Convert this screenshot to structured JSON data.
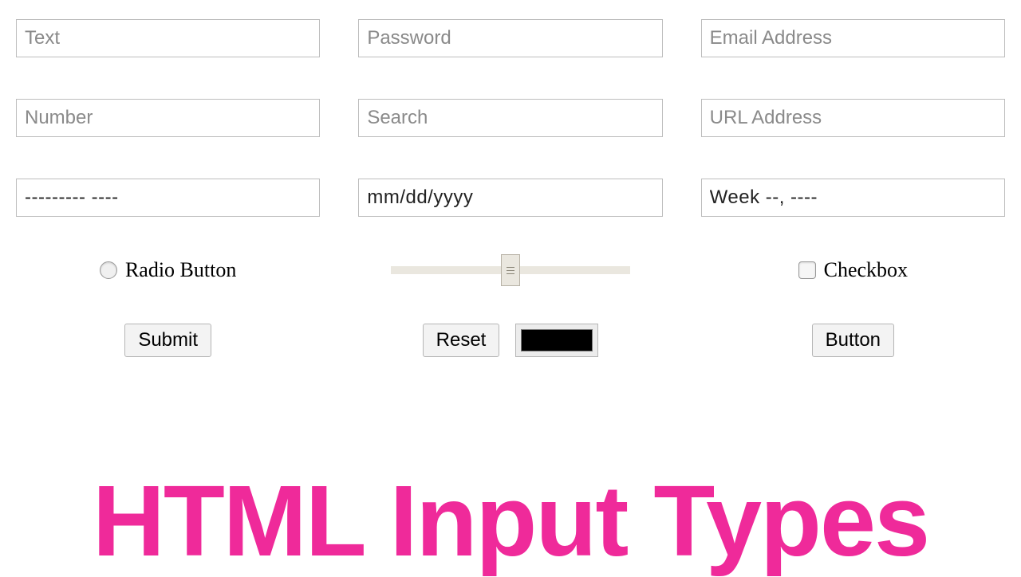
{
  "row1": {
    "text": {
      "placeholder": "Text"
    },
    "password": {
      "placeholder": "Password"
    },
    "email": {
      "placeholder": "Email Address"
    }
  },
  "row2": {
    "number": {
      "placeholder": "Number"
    },
    "search": {
      "placeholder": "Search"
    },
    "url": {
      "placeholder": "URL Address"
    }
  },
  "row3": {
    "month": {
      "value": "--------- ----"
    },
    "date": {
      "value": "mm/dd/yyyy"
    },
    "week": {
      "value": "Week --, ----"
    }
  },
  "row4": {
    "radio_label": "Radio Button",
    "checkbox_label": "Checkbox",
    "range": {
      "min": 0,
      "max": 100,
      "value": 50
    }
  },
  "row5": {
    "submit": "Submit",
    "reset": "Reset",
    "button": "Button",
    "color_value": "#000000"
  },
  "title": "HTML Input Types",
  "colors": {
    "accent": "#ef2a9a"
  }
}
